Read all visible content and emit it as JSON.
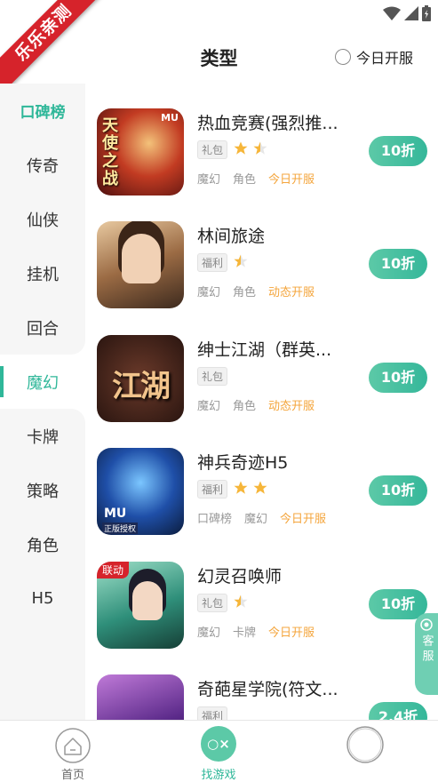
{
  "status": {
    "ribbon": "乐乐亲测"
  },
  "header": {
    "title": "类型",
    "today_label": "今日开服"
  },
  "sidebar": {
    "items": [
      {
        "label": "口碑榜"
      },
      {
        "label": "传奇"
      },
      {
        "label": "仙侠"
      },
      {
        "label": "挂机"
      },
      {
        "label": "回合"
      },
      {
        "label": "魔幻"
      },
      {
        "label": "卡牌"
      },
      {
        "label": "策略"
      },
      {
        "label": "角色"
      },
      {
        "label": "H5"
      }
    ],
    "active": "魔幻"
  },
  "games": [
    {
      "name": "热血竞赛(强烈推...",
      "tag": "礼包",
      "stars": 1.5,
      "meta": [
        "魔幻",
        "角色"
      ],
      "highlight": "今日开服",
      "discount": "10折",
      "thumb_text": "天使之战",
      "thumb_badge": "MU"
    },
    {
      "name": "林间旅途",
      "tag": "福利",
      "stars": 0.5,
      "meta": [
        "魔幻",
        "角色"
      ],
      "highlight": "动态开服",
      "discount": "10折"
    },
    {
      "name": "绅士江湖（群英...",
      "tag": "礼包",
      "stars": 0,
      "meta": [
        "魔幻",
        "角色"
      ],
      "highlight": "动态开服",
      "discount": "10折",
      "thumb_text": "江湖"
    },
    {
      "name": "神兵奇迹H5",
      "tag": "福利",
      "stars": 2,
      "meta": [
        "口碑榜",
        "魔幻"
      ],
      "highlight": "今日开服",
      "discount": "10折",
      "thumb_badge": "MU",
      "thumb_sub": "正版授权"
    },
    {
      "name": "幻灵召唤师",
      "tag": "礼包",
      "stars": 0.5,
      "meta": [
        "魔幻",
        "卡牌"
      ],
      "highlight": "今日开服",
      "discount": "10折",
      "thumb_badge": "联动"
    },
    {
      "name": "奇葩星学院(符文...",
      "tag": "福利",
      "stars": 0,
      "meta": [],
      "highlight": "",
      "discount": "2.4折"
    }
  ],
  "service": {
    "label": "客服"
  },
  "nav": {
    "home": "首页",
    "find": "找游戏",
    "find_icon": "○×"
  },
  "colors": {
    "accent": "#2fb799",
    "highlight": "#f4a53c",
    "star": "#f6b63a",
    "ribbon": "#d6232b"
  }
}
